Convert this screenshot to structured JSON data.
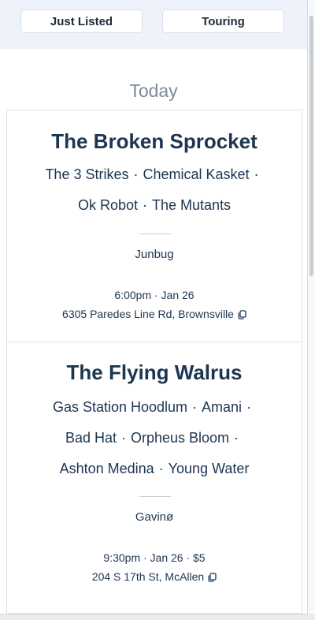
{
  "filters": {
    "just_listed": "Just Listed",
    "touring": "Touring"
  },
  "day_heading": "Today",
  "events": [
    {
      "venue": "The Broken Sprocket",
      "lineup_rows": [
        [
          "The 3 Strikes",
          "Chemical Kasket"
        ],
        [
          "Ok Robot",
          "The Mutants"
        ]
      ],
      "promoter": "Junbug",
      "time": "6:00pm · Jan 26",
      "address": "6305 Paredes Line Rd, Brownsville"
    },
    {
      "venue": "The Flying Walrus",
      "lineup_rows": [
        [
          "Gas Station Hoodlum",
          "Amani"
        ],
        [
          "Bad Hat",
          "Orpheus Bloom"
        ],
        [
          "Ashton Medina",
          "Young Water"
        ]
      ],
      "promoter": "Gavinø",
      "time": "9:30pm · Jan 26 · $5",
      "address": "204 S 17th St, McAllen"
    }
  ],
  "separator": "·",
  "icons": {
    "copy": "copy-icon"
  },
  "colors": {
    "topbar_bg": "#eef3fb",
    "text_primary": "#1d3550",
    "heading_muted": "#7d8a96"
  }
}
